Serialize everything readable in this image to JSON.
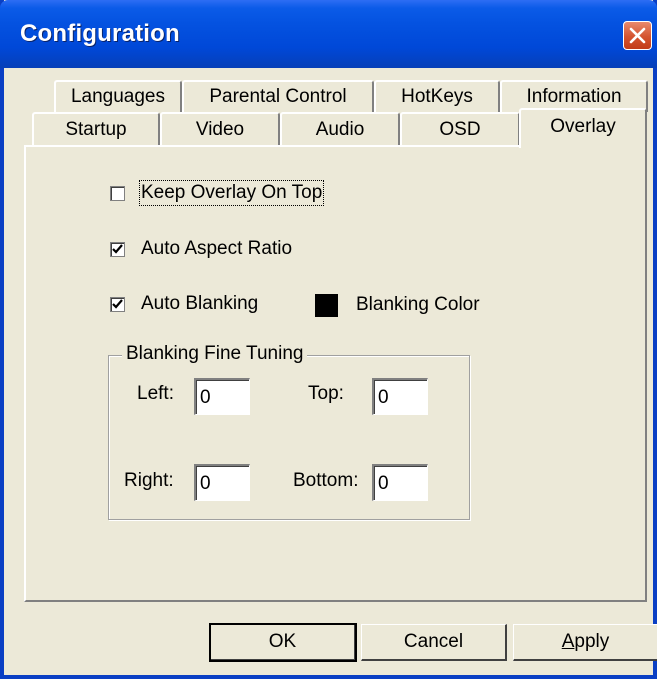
{
  "window": {
    "title": "Configuration"
  },
  "tabs_row1": [
    {
      "label": "Languages"
    },
    {
      "label": "Parental Control"
    },
    {
      "label": "HotKeys"
    },
    {
      "label": "Information"
    }
  ],
  "tabs_row2": [
    {
      "label": "Startup"
    },
    {
      "label": "Video"
    },
    {
      "label": "Audio"
    },
    {
      "label": "OSD"
    },
    {
      "label": "Overlay",
      "active": true
    }
  ],
  "overlay": {
    "keep_on_top": {
      "label": "Keep Overlay On Top",
      "checked": false
    },
    "auto_aspect": {
      "label": "Auto Aspect Ratio",
      "checked": true
    },
    "auto_blanking": {
      "label": "Auto Blanking",
      "checked": true
    },
    "blanking_color": {
      "label": "Blanking Color",
      "color": "#000000"
    },
    "fine_tuning": {
      "title": "Blanking Fine Tuning",
      "left": {
        "label": "Left:",
        "value": "0"
      },
      "top": {
        "label": "Top:",
        "value": "0"
      },
      "right": {
        "label": "Right:",
        "value": "0"
      },
      "bottom": {
        "label": "Bottom:",
        "value": "0"
      }
    }
  },
  "buttons": {
    "ok": "OK",
    "cancel": "Cancel",
    "apply_u": "A",
    "apply_rest": "pply"
  },
  "colors": {
    "title_bar": "#0452E0",
    "face": "#ECE9D8",
    "close": "#D4532F"
  }
}
